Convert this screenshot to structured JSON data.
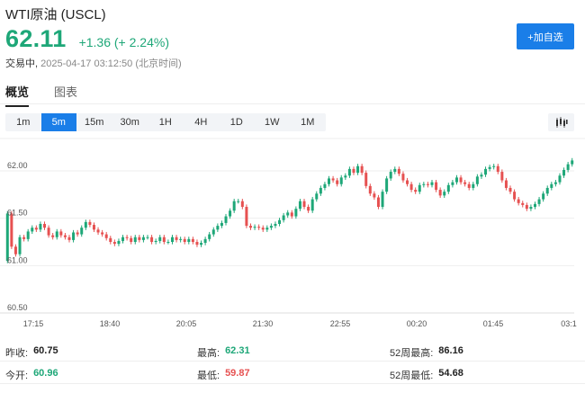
{
  "header": {
    "title": "WTI原油 (USCL)",
    "price": "62.11",
    "change": "+1.36 (+ 2.24%)",
    "state": "交易中,",
    "timestamp": "2025-04-17 03:12:50",
    "timezone": "(北京时间)",
    "add_button": "+加自选"
  },
  "tabs": [
    {
      "label": "概览",
      "active": true
    },
    {
      "label": "图表",
      "active": false
    }
  ],
  "intervals": [
    {
      "label": "1m",
      "active": false
    },
    {
      "label": "5m",
      "active": true
    },
    {
      "label": "15m",
      "active": false
    },
    {
      "label": "30m",
      "active": false
    },
    {
      "label": "1H",
      "active": false
    },
    {
      "label": "4H",
      "active": false
    },
    {
      "label": "1D",
      "active": false
    },
    {
      "label": "1W",
      "active": false
    },
    {
      "label": "1M",
      "active": false
    }
  ],
  "chart_type_icon": "candlestick-icon",
  "colors": {
    "up": "#1ea778",
    "down": "#e65151",
    "accent": "#1a7ee8"
  },
  "stats": {
    "prev_close": {
      "label": "昨收:",
      "value": "60.75"
    },
    "open": {
      "label": "今开:",
      "value": "60.96"
    },
    "high": {
      "label": "最高:",
      "value": "62.31"
    },
    "low": {
      "label": "最低:",
      "value": "59.87"
    },
    "high52": {
      "label": "52周最高:",
      "value": "86.16"
    },
    "low52": {
      "label": "52周最低:",
      "value": "54.68"
    }
  },
  "chart_data": {
    "type": "candlestick",
    "y_ticks": [
      "62.00",
      "61.50",
      "61.00",
      "60.50"
    ],
    "ylim": [
      60.5,
      62.3
    ],
    "x_ticks": [
      "17:15",
      "18:40",
      "20:05",
      "21:30",
      "22:55",
      "00:20",
      "01:45",
      "03:1"
    ],
    "close": [
      61.55,
      61.2,
      61.12,
      61.3,
      61.28,
      61.36,
      61.4,
      61.38,
      61.44,
      61.4,
      61.32,
      61.3,
      61.36,
      61.32,
      61.3,
      61.27,
      61.35,
      61.33,
      61.4,
      61.46,
      61.43,
      61.38,
      61.35,
      61.33,
      61.29,
      61.25,
      61.23,
      61.26,
      61.3,
      61.29,
      61.25,
      61.3,
      61.27,
      61.3,
      61.3,
      61.25,
      61.26,
      61.3,
      61.25,
      61.25,
      61.3,
      61.27,
      61.28,
      61.25,
      61.28,
      61.25,
      61.22,
      61.24,
      61.28,
      61.33,
      61.38,
      61.42,
      61.45,
      61.52,
      61.58,
      61.68,
      61.68,
      61.62,
      61.42,
      61.4,
      61.41,
      61.4,
      61.38,
      61.4,
      61.42,
      61.44,
      61.48,
      61.53,
      61.56,
      61.52,
      61.6,
      61.68,
      61.62,
      61.58,
      61.7,
      61.76,
      61.82,
      61.86,
      61.92,
      61.9,
      61.86,
      61.93,
      61.95,
      62.02,
      61.98,
      62.05,
      61.98,
      61.84,
      61.76,
      61.72,
      61.62,
      61.78,
      61.92,
      61.99,
      62.02,
      61.97,
      61.9,
      61.86,
      61.8,
      61.78,
      61.85,
      61.86,
      61.85,
      61.88,
      61.8,
      61.74,
      61.78,
      61.85,
      61.88,
      61.93,
      61.88,
      61.86,
      61.82,
      61.86,
      61.94,
      61.96,
      62.02,
      62.04,
      62.05,
      61.99,
      61.9,
      61.82,
      61.78,
      61.7,
      61.66,
      61.64,
      61.6,
      61.62,
      61.65,
      61.7,
      61.76,
      61.82,
      61.86,
      61.88,
      61.95,
      62.01,
      62.07,
      62.11
    ]
  },
  "x_values_not_visible": "timestamps of individual candles between 17:15 and 03:12 not printed"
}
